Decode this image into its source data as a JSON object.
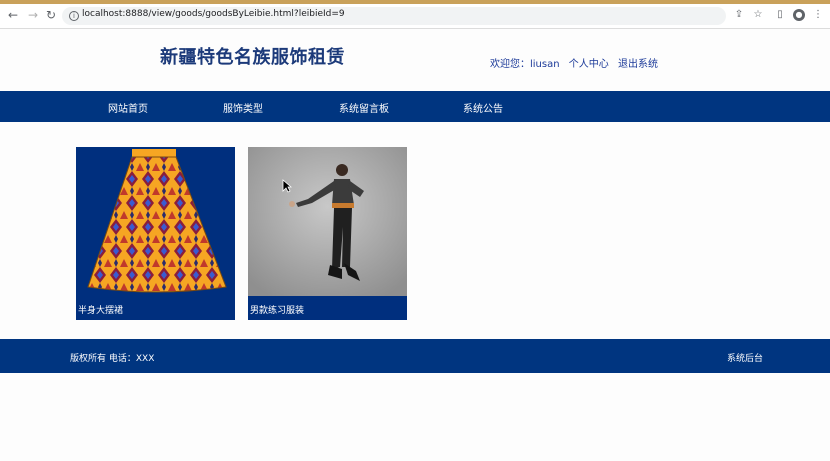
{
  "browser": {
    "url": "localhost:8888/view/goods/goodsByLeibie.html?leibieId=9"
  },
  "site": {
    "title": "新疆特色名族服饰租赁"
  },
  "user": {
    "greeting": "欢迎您：liusan",
    "profile_label": "个人中心",
    "logout_label": "退出系统"
  },
  "nav": {
    "items": [
      {
        "label": "网站首页"
      },
      {
        "label": "服饰类型"
      },
      {
        "label": "系统留言板"
      },
      {
        "label": "系统公告"
      }
    ]
  },
  "products": [
    {
      "name": "半身大摆裙"
    },
    {
      "name": "男款练习服装"
    }
  ],
  "footer": {
    "copyright": "版权所有 电话：XXX",
    "admin_label": "系统后台"
  },
  "colors": {
    "brand_blue": "#003580",
    "title_blue": "#1c3a7a"
  }
}
